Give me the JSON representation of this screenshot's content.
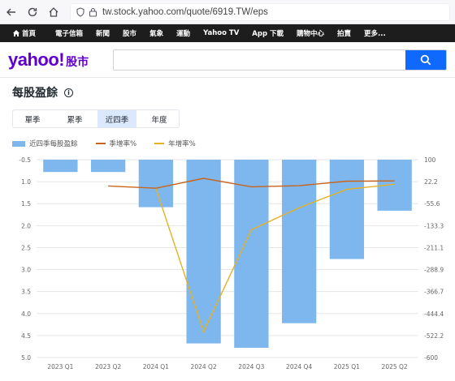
{
  "browser": {
    "url": "tw.stock.yahoo.com/quote/6919.TW/eps"
  },
  "topnav": {
    "items": [
      "首頁",
      "電子信箱",
      "新聞",
      "股市",
      "氣象",
      "運動",
      "Yahoo TV",
      "App 下載",
      "購物中心",
      "拍賣",
      "更多..."
    ]
  },
  "header": {
    "logo_text": "yahoo!",
    "logo_sub": "股市",
    "search_placeholder": ""
  },
  "section": {
    "title": "每股盈餘"
  },
  "tabs": [
    {
      "label": "單季",
      "active": false
    },
    {
      "label": "累季",
      "active": false
    },
    {
      "label": "近四季",
      "active": true
    },
    {
      "label": "年度",
      "active": false
    }
  ],
  "legend": {
    "bar": "近四季每股盈餘",
    "qoq": "季增率%",
    "yoy": "年增率%"
  },
  "colors": {
    "bar": "#7eb6ee",
    "qoq": "#c8651b",
    "yoy": "#e3b224",
    "brand": "#6001d2",
    "search": "#0f69ff"
  },
  "chart_data": {
    "type": "bar",
    "categories": [
      "2023 Q1",
      "2023 Q2",
      "2024 Q1",
      "2024 Q2",
      "2024 Q3",
      "2024 Q4",
      "2025 Q1",
      "2025 Q2"
    ],
    "left_axis": {
      "ticks": [
        "-0.5",
        "1.0",
        "1.5",
        "2.0",
        "2.5",
        "3.0",
        "3.5",
        "4.0",
        "4.5",
        "5.0"
      ],
      "ylim": [
        -0.5,
        -5.0
      ]
    },
    "right_axis": {
      "ticks": [
        "100",
        "22.2",
        "-55.6",
        "-133.3",
        "-211.1",
        "-288.9",
        "-366.7",
        "-444.4",
        "-522.2",
        "-600"
      ],
      "ylim": [
        100,
        -600
      ]
    },
    "series": [
      {
        "name": "近四季每股盈餘",
        "type": "bar",
        "values": [
          -0.78,
          -0.78,
          -1.58,
          -4.68,
          -4.78,
          -4.22,
          -2.76,
          -1.66
        ]
      },
      {
        "name": "季增率%",
        "type": "line",
        "values": [
          null,
          7.0,
          -1.0,
          34,
          4.0,
          8.0,
          24.0,
          25.0
        ]
      },
      {
        "name": "年增率%",
        "type": "line",
        "values": [
          null,
          null,
          -2.0,
          -509,
          -148,
          -70,
          -5.0,
          13.0
        ]
      }
    ]
  }
}
